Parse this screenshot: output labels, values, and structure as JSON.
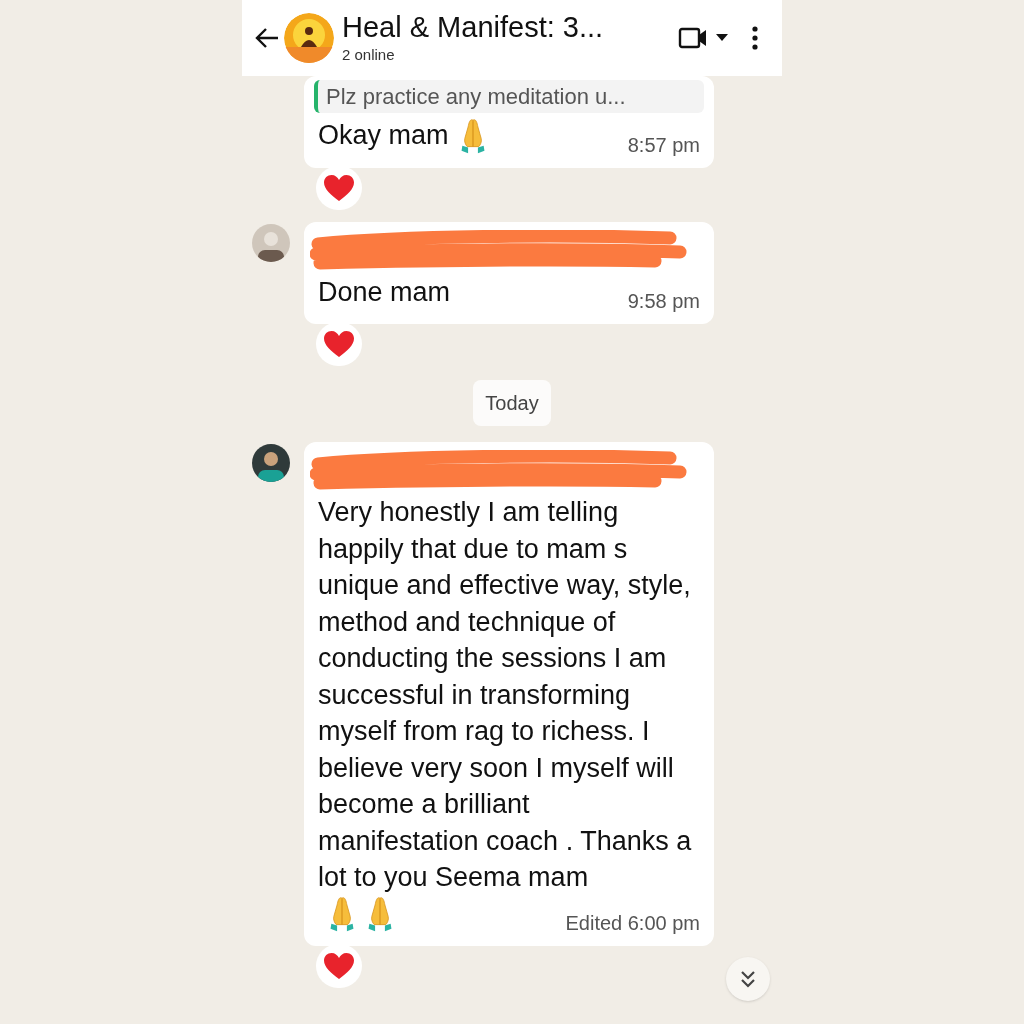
{
  "header": {
    "title": "Heal & Manifest: 3...",
    "subtitle": "2 online"
  },
  "messages": [
    {
      "kind": "message",
      "avatar": false,
      "sender_redacted": false,
      "quote": "Plz practice any meditation u...",
      "text": "Okay mam",
      "emoji": [
        {
          "kind": "pray"
        }
      ],
      "time": "8:57 pm",
      "reaction": {
        "kind": "heart"
      }
    },
    {
      "kind": "message",
      "avatar": true,
      "sender_redacted": true,
      "text": "Done mam",
      "time": "9:58 pm",
      "reaction": {
        "kind": "heart"
      }
    },
    {
      "kind": "date",
      "text": "Today"
    },
    {
      "kind": "message",
      "avatar": true,
      "sender_redacted": true,
      "text": "Very honestly I am telling happily that due to mam s unique and effective way, style, method and technique of conducting the sessions I am successful in transforming myself from rag to richess. I believe very soon I myself will become a brilliant manifestation coach . Thanks a lot to you Seema mam",
      "emoji": [
        {
          "kind": "pray"
        },
        {
          "kind": "pray"
        }
      ],
      "time": "Edited 6:00 pm",
      "reaction": {
        "kind": "heart"
      }
    }
  ]
}
